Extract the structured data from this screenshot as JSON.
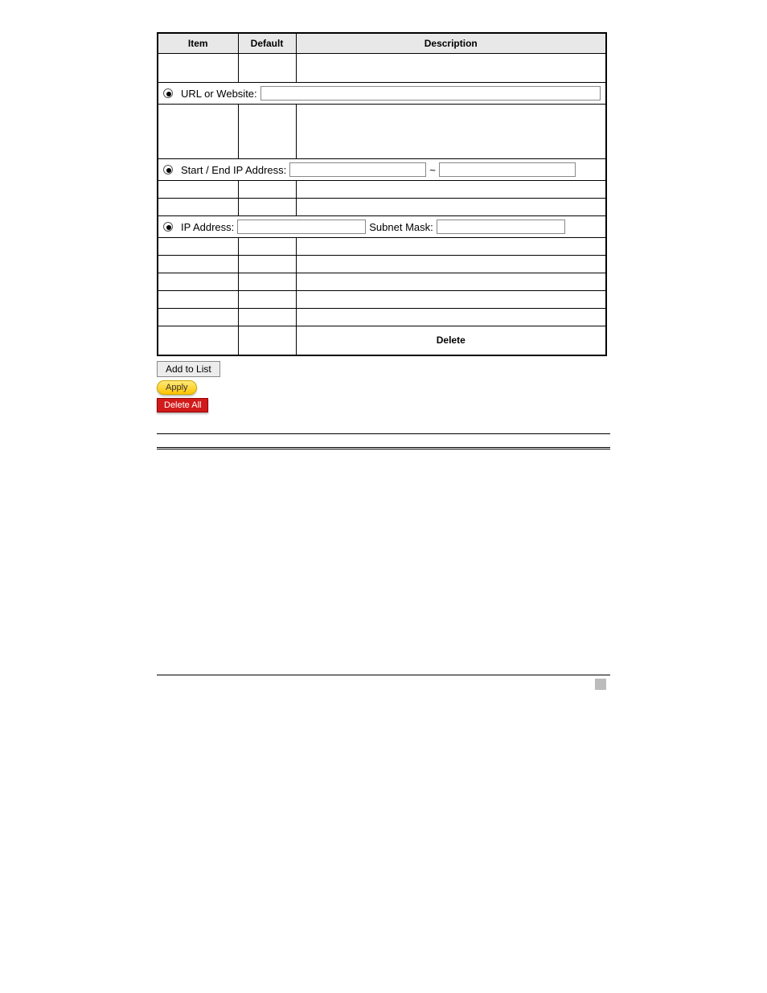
{
  "table": {
    "headers": {
      "item": "Item",
      "default": "Default",
      "description": "Description"
    },
    "url_row": {
      "label": "URL or Website:"
    },
    "ip_range_row": {
      "label": "Start / End IP Address:",
      "sep": "~"
    },
    "ip_subnet_row": {
      "label": "IP Address:",
      "subnet_label": "Subnet Mask:"
    },
    "delete_row": {
      "label": "Delete"
    }
  },
  "buttons": {
    "add_to_list": "Add to List",
    "apply": "Apply",
    "delete_all": "Delete All"
  }
}
